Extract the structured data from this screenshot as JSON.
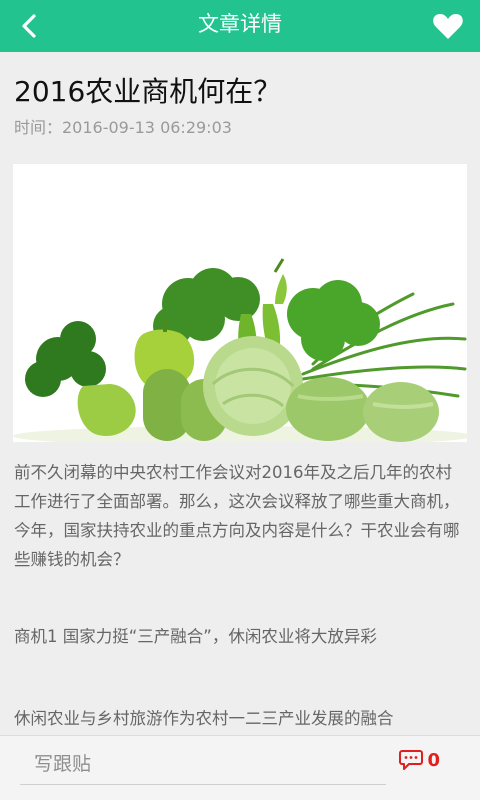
{
  "header": {
    "title": "文章详情",
    "back_icon": "chevron-left-icon",
    "favorite_icon": "heart-icon",
    "background_color": "#22c38e"
  },
  "article": {
    "title": "2016农业商机何在？",
    "time": "时间：2016-09-13 06:29:03",
    "image": "green-vegetables-photo",
    "paragraphs": [
      "前不久闭幕的中央农村工作会议对2016年及之后几年的农村工作进行了全面部署。那么，这次会议释放了哪些重大商机，今年，国家扶持农业的重点方向及内容是什么？干农业会有哪些赚钱的机会？",
      "商机1 国家力挺“三产融合”，休闲农业将大放异彩",
      "休闲农业与乡村旅游作为农村一二三产业发展的融合"
    ]
  },
  "footer": {
    "reply_placeholder": "写跟贴",
    "comment_icon": "comment-bubble-icon",
    "comment_count": "0",
    "accent_color": "#e02020"
  }
}
